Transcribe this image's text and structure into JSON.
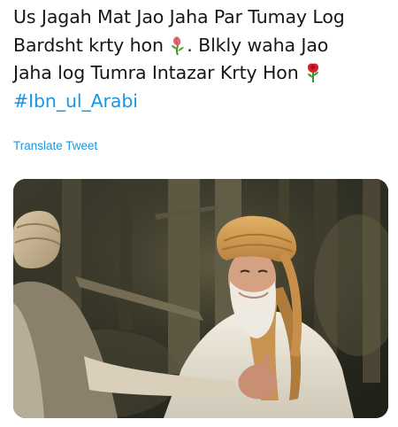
{
  "tweet": {
    "line_1": "Us Jagah Mat Jao Jaha Par Tumay Log",
    "line_2a": "Bardsht krty hon",
    "line_2b": ". Blkly waha Jao",
    "line_3": "Jaha log Tumra Intazar Krty Hon",
    "hashtag": "#Ibn_ul_Arabi",
    "emoji_1": "wilted-flower-icon",
    "emoji_2": "rose-icon"
  },
  "translate": {
    "label": "Translate Tweet"
  },
  "media": {
    "description_icon": "photo"
  },
  "colors": {
    "link": "#1b95e0",
    "text": "#14171a"
  }
}
